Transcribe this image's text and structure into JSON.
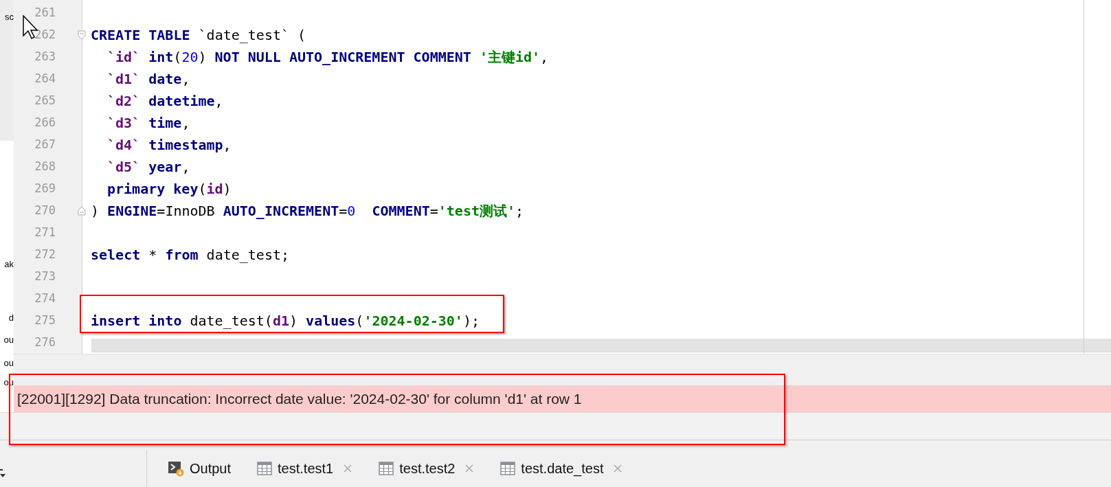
{
  "side_panel": {
    "fragments": [
      "sc",
      "ak",
      "d",
      "ou",
      "ou",
      "ou"
    ]
  },
  "editor": {
    "lines": [
      {
        "number": "261"
      },
      {
        "number": "262",
        "fold_open": true,
        "tokens": [
          {
            "t": "CREATE TABLE ",
            "kind": "kw"
          },
          {
            "t": "`date_test` (",
            "kind": "plain"
          }
        ]
      },
      {
        "number": "263",
        "indent": true,
        "tokens": [
          {
            "t": "`id`",
            "kind": "field"
          },
          {
            "t": " int",
            "kind": "kw"
          },
          {
            "t": "(",
            "kind": "plain"
          },
          {
            "t": "20",
            "kind": "num"
          },
          {
            "t": ") ",
            "kind": "plain"
          },
          {
            "t": "NOT NULL AUTO_INCREMENT COMMENT ",
            "kind": "kw"
          },
          {
            "t": "'主键id'",
            "kind": "str"
          },
          {
            "t": ",",
            "kind": "plain"
          }
        ]
      },
      {
        "number": "264",
        "indent": true,
        "tokens": [
          {
            "t": "`d1`",
            "kind": "field"
          },
          {
            "t": " date",
            "kind": "kw"
          },
          {
            "t": ",",
            "kind": "plain"
          }
        ]
      },
      {
        "number": "265",
        "indent": true,
        "tokens": [
          {
            "t": "`d2`",
            "kind": "field"
          },
          {
            "t": " datetime",
            "kind": "kw"
          },
          {
            "t": ",",
            "kind": "plain"
          }
        ]
      },
      {
        "number": "266",
        "indent": true,
        "tokens": [
          {
            "t": "`d3`",
            "kind": "field"
          },
          {
            "t": " time",
            "kind": "kw"
          },
          {
            "t": ",",
            "kind": "plain"
          }
        ]
      },
      {
        "number": "267",
        "indent": true,
        "tokens": [
          {
            "t": "`d4`",
            "kind": "field"
          },
          {
            "t": " timestamp",
            "kind": "kw"
          },
          {
            "t": ",",
            "kind": "plain"
          }
        ]
      },
      {
        "number": "268",
        "indent": true,
        "tokens": [
          {
            "t": "`d5`",
            "kind": "field"
          },
          {
            "t": " year",
            "kind": "kw"
          },
          {
            "t": ",",
            "kind": "plain"
          }
        ]
      },
      {
        "number": "269",
        "indent": true,
        "tokens": [
          {
            "t": "primary key",
            "kind": "kw"
          },
          {
            "t": "(",
            "kind": "plain"
          },
          {
            "t": "id",
            "kind": "field"
          },
          {
            "t": ")",
            "kind": "plain"
          }
        ]
      },
      {
        "number": "270",
        "fold_close": true,
        "tokens": [
          {
            "t": ") ",
            "kind": "plain"
          },
          {
            "t": "ENGINE",
            "kind": "kw"
          },
          {
            "t": "=InnoDB ",
            "kind": "plain"
          },
          {
            "t": "AUTO_INCREMENT",
            "kind": "kw"
          },
          {
            "t": "=",
            "kind": "plain"
          },
          {
            "t": "0",
            "kind": "num"
          },
          {
            "t": "  COMMENT",
            "kind": "kw"
          },
          {
            "t": "=",
            "kind": "plain"
          },
          {
            "t": "'test测试'",
            "kind": "str"
          },
          {
            "t": ";",
            "kind": "plain"
          }
        ]
      },
      {
        "number": "271"
      },
      {
        "number": "272",
        "tokens": [
          {
            "t": "select ",
            "kind": "kw"
          },
          {
            "t": "* ",
            "kind": "plain"
          },
          {
            "t": "from ",
            "kind": "kw"
          },
          {
            "t": "date_test;",
            "kind": "plain"
          }
        ]
      },
      {
        "number": "273"
      },
      {
        "number": "274"
      },
      {
        "number": "275",
        "highlighted": true,
        "tokens": [
          {
            "t": "insert into ",
            "kind": "kw"
          },
          {
            "t": "date_test(",
            "kind": "plain"
          },
          {
            "t": "d1",
            "kind": "field"
          },
          {
            "t": ") ",
            "kind": "plain"
          },
          {
            "t": "values",
            "kind": "kw"
          },
          {
            "t": "(",
            "kind": "plain"
          },
          {
            "t": "'2024-02-30'",
            "kind": "str"
          },
          {
            "t": ");",
            "kind": "plain"
          }
        ]
      },
      {
        "number": "276"
      }
    ]
  },
  "output": {
    "message": "[22001][1292] Data truncation: Incorrect date value: '2024-02-30' for column 'd1' at row 1",
    "highlighted": true
  },
  "tabs": [
    {
      "label": "Output",
      "kind": "console",
      "closable": false
    },
    {
      "label": "test.test1",
      "kind": "table",
      "closable": true
    },
    {
      "label": "test.test2",
      "kind": "table",
      "closable": true
    },
    {
      "label": "test.date_test",
      "kind": "table",
      "closable": true
    }
  ]
}
